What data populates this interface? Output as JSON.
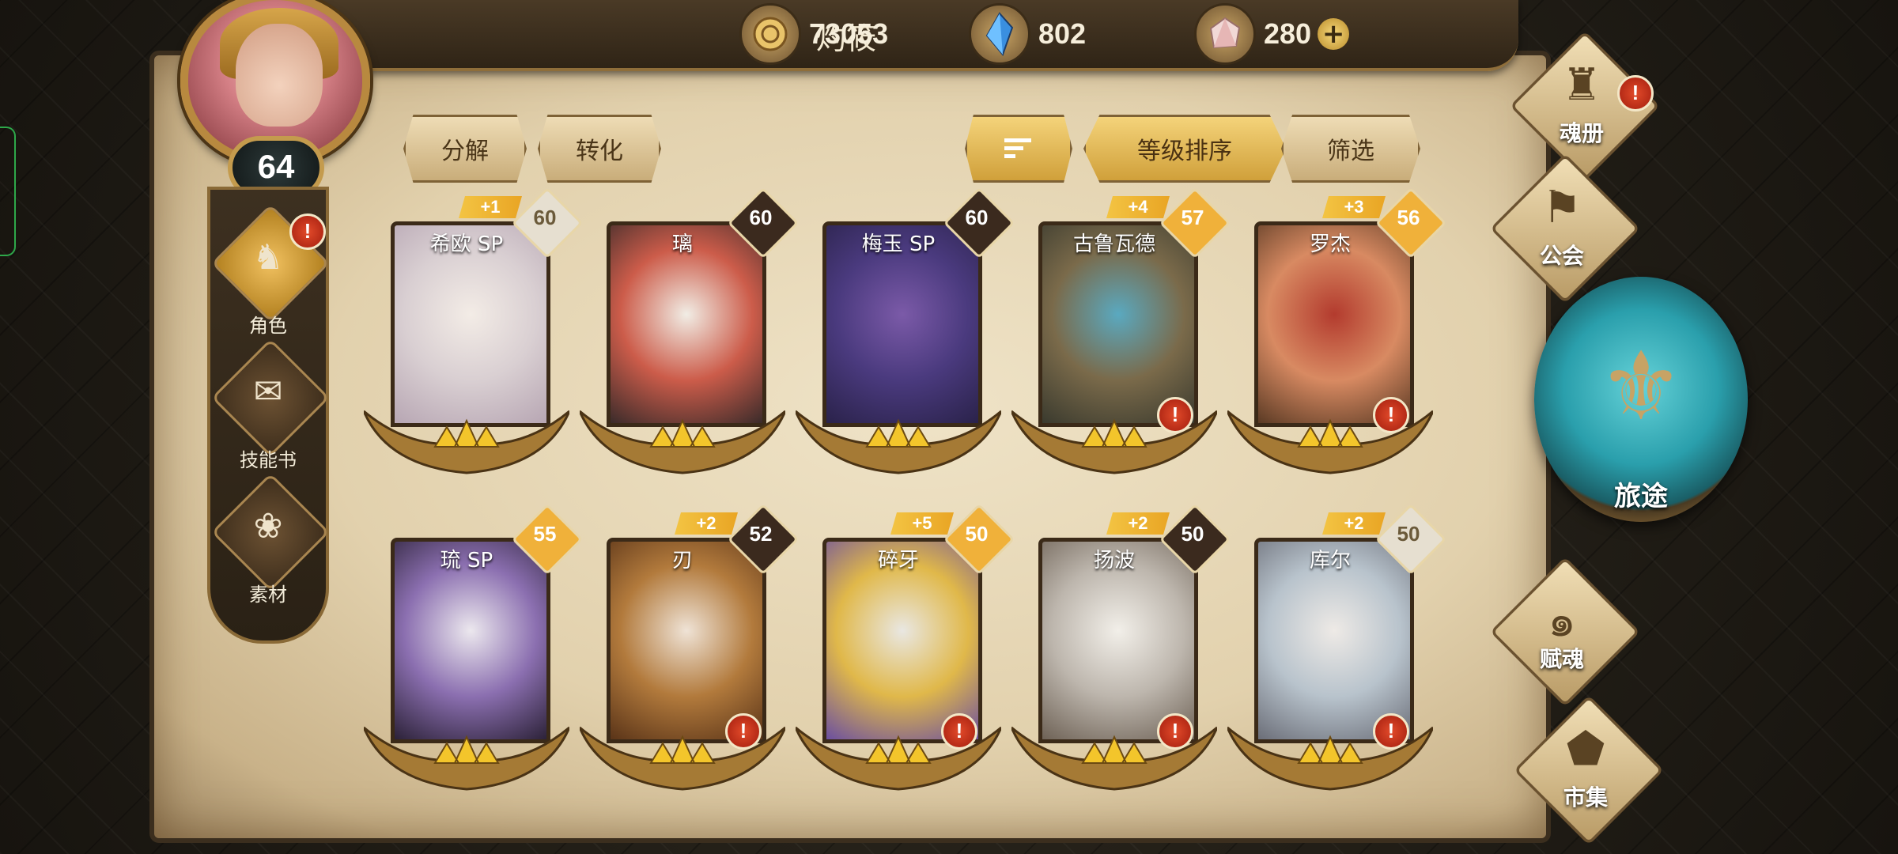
{
  "header": {
    "player_name": "灼筱",
    "gold": "73053",
    "crystal": "802",
    "gem": "280",
    "plus": "+"
  },
  "player": {
    "level": "64"
  },
  "left_menu": [
    {
      "label": "角色",
      "icon": "character-icon",
      "active": true,
      "alert": true
    },
    {
      "label": "技能书",
      "icon": "skill-book-icon",
      "active": false,
      "alert": false
    },
    {
      "label": "素材",
      "icon": "material-icon",
      "active": false,
      "alert": false
    }
  ],
  "toolbar": {
    "decompose": "分解",
    "convert": "转化",
    "sort_label": "等级排序",
    "filter": "筛选"
  },
  "cards": [
    {
      "name": "希欧 SP",
      "level": "60",
      "plus": "+1",
      "alert": false,
      "diamond": "#e6dfd0",
      "art": [
        "#f3ece6",
        "#d9cfd2",
        "#b7a6b3"
      ]
    },
    {
      "name": "璃",
      "level": "60",
      "plus": "",
      "alert": false,
      "diamond": "#3b2a1e",
      "art": [
        "#f1ede5",
        "#cc5c4a",
        "#3a2b2a"
      ]
    },
    {
      "name": "梅玉 SP",
      "level": "60",
      "plus": "",
      "alert": false,
      "diamond": "#3b2a1e",
      "art": [
        "#7b5aa8",
        "#4a3a7e",
        "#2a224a"
      ]
    },
    {
      "name": "古鲁瓦德",
      "level": "57",
      "plus": "+4",
      "alert": true,
      "diamond": "#f0b13a",
      "art": [
        "#5aa9c0",
        "#7a6a4a",
        "#3a3a2e"
      ]
    },
    {
      "name": "罗杰",
      "level": "56",
      "plus": "+3",
      "alert": true,
      "diamond": "#f0b13a",
      "art": [
        "#b33b2e",
        "#d88a62",
        "#5a3a24"
      ]
    },
    {
      "name": "琉 SP",
      "level": "55",
      "plus": "",
      "alert": false,
      "diamond": "#f0b13a",
      "art": [
        "#ece8ee",
        "#8b6fb0",
        "#2c2238"
      ]
    },
    {
      "name": "刃",
      "level": "52",
      "plus": "+2",
      "alert": true,
      "diamond": "#3b2a1e",
      "art": [
        "#efe3d6",
        "#b27a3c",
        "#5a3418"
      ]
    },
    {
      "name": "碎牙",
      "level": "50",
      "plus": "+5",
      "alert": true,
      "diamond": "#f0b13a",
      "art": [
        "#e9e7e2",
        "#e0b84a",
        "#6b4fa0"
      ]
    },
    {
      "name": "扬波",
      "level": "50",
      "plus": "+2",
      "alert": true,
      "diamond": "#3b2a1e",
      "art": [
        "#f2efe9",
        "#bdb6ad",
        "#6e6256"
      ]
    },
    {
      "name": "库尔",
      "level": "50",
      "plus": "+2",
      "alert": true,
      "diamond": "#e6dfd0",
      "art": [
        "#eeeae6",
        "#b8c3cc",
        "#6b6e78"
      ]
    }
  ],
  "right_menu": [
    {
      "label": "魂册",
      "icon": "soul-book-icon",
      "alert": true
    },
    {
      "label": "公会",
      "icon": "guild-icon",
      "alert": false
    },
    {
      "label": "赋魂",
      "icon": "soul-infuse-icon",
      "alert": false
    },
    {
      "label": "市集",
      "icon": "market-icon",
      "alert": false
    }
  ],
  "journey": {
    "label": "旅途",
    "icon": "journey-icon"
  },
  "alert_glyph": "!"
}
